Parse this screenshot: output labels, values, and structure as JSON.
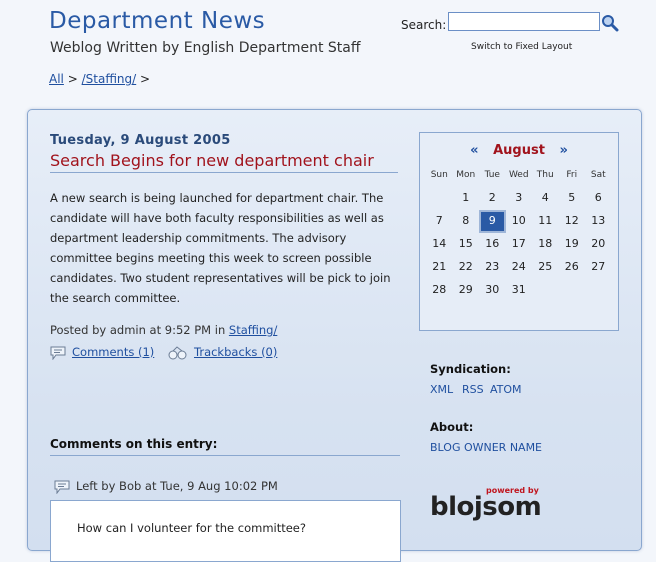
{
  "header": {
    "title": "Department News",
    "subtitle": "Weblog Written by English Department Staff",
    "search_label": "Search:",
    "search_value": "",
    "layout_link": "Switch to Fixed Layout"
  },
  "breadcrumb": {
    "all": "All",
    "sep1": ">",
    "category": "/Staffing/",
    "sep2": ">"
  },
  "entry": {
    "date": "Tuesday, 9 August 2005",
    "title": "Search Begins for new department chair",
    "body": "A new search is being launched for department chair. The candidate will have both faculty responsibilities as well as department leadership commitments. The advisory committee begins meeting this week to screen possible candidates. Two student representatives will be pick to join the search committee.",
    "posted_by": "Posted by admin at 9:52 PM in",
    "posted_category": "Staffing/",
    "comments_link": "Comments (1)",
    "trackbacks_link": "Trackbacks (0)"
  },
  "comments": {
    "heading": "Comments on this entry:",
    "items": [
      {
        "meta": "Left by Bob at Tue, 9 Aug 10:02 PM",
        "text": "How can I volunteer for the committee?"
      }
    ]
  },
  "calendar": {
    "prev": "«",
    "month": "August",
    "next": "»",
    "weekdays": [
      "Sun",
      "Mon",
      "Tue",
      "Wed",
      "Thu",
      "Fri",
      "Sat"
    ],
    "leading_blanks": 1,
    "days": [
      "1",
      "2",
      "3",
      "4",
      "5",
      "6",
      "7",
      "8",
      "9",
      "10",
      "11",
      "12",
      "13",
      "14",
      "15",
      "16",
      "17",
      "18",
      "19",
      "20",
      "21",
      "22",
      "23",
      "24",
      "25",
      "26",
      "27",
      "28",
      "29",
      "30",
      "31"
    ],
    "today": "9"
  },
  "sidebar": {
    "syndication_heading": "Syndication:",
    "feeds": [
      "XML",
      "RSS",
      "ATOM"
    ],
    "about_heading": "About:",
    "about_link": "BLOG OWNER NAME"
  },
  "logo": {
    "powered": "powered by",
    "name": "blojsom"
  },
  "colors": {
    "accent": "#2a5aa5",
    "title_red": "#a1131c",
    "link": "#1f4f9f"
  }
}
